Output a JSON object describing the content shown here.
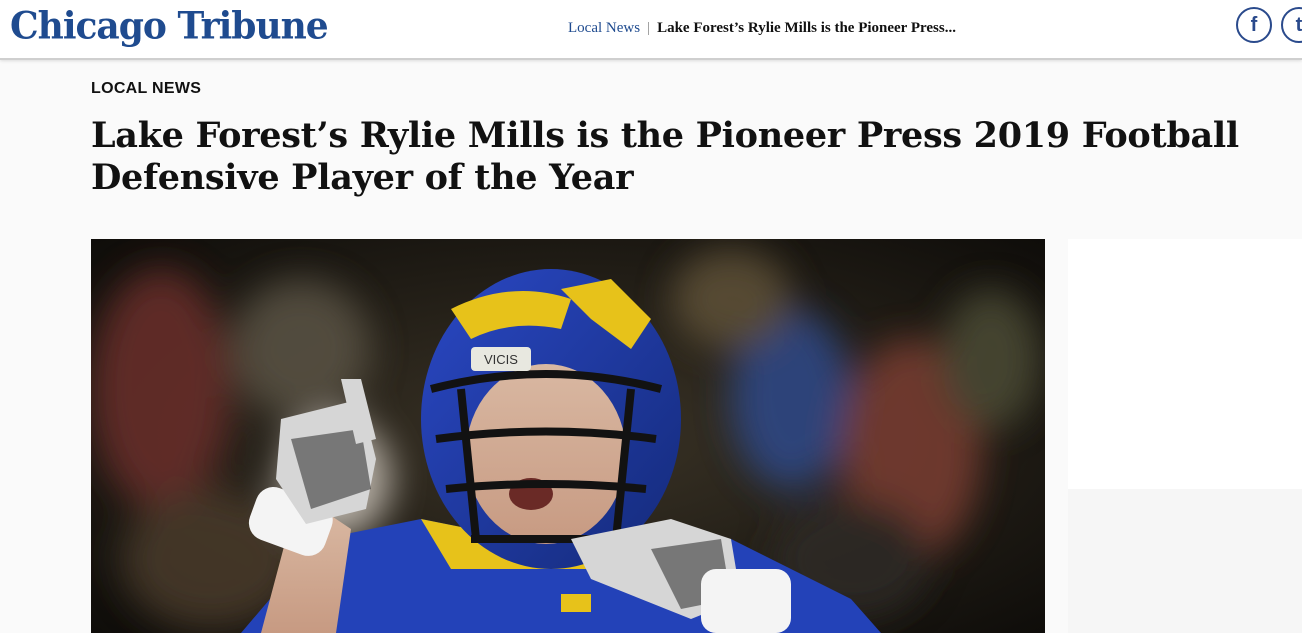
{
  "header": {
    "logo": "Chicago Tribune",
    "breadcrumb_section": "Local News",
    "breadcrumb_separator": "|",
    "breadcrumb_headline": "Lake Forest’s Rylie Mills is the Pioneer Press...",
    "social": [
      {
        "icon": "facebook-icon",
        "glyph": "f"
      },
      {
        "icon": "twitter-icon",
        "glyph": "t"
      }
    ]
  },
  "article": {
    "section": "LOCAL NEWS",
    "title": "Lake Forest’s Rylie Mills is the Pioneer Press 2019 Football Defensive Player of the Year",
    "photo": {
      "alt_icon": "football-player-photo",
      "helmet_text": "VICIS"
    }
  },
  "colors": {
    "brand_blue": "#1f4b8f",
    "jersey_blue": "#2342b8",
    "helmet_gold": "#e7c21a"
  }
}
